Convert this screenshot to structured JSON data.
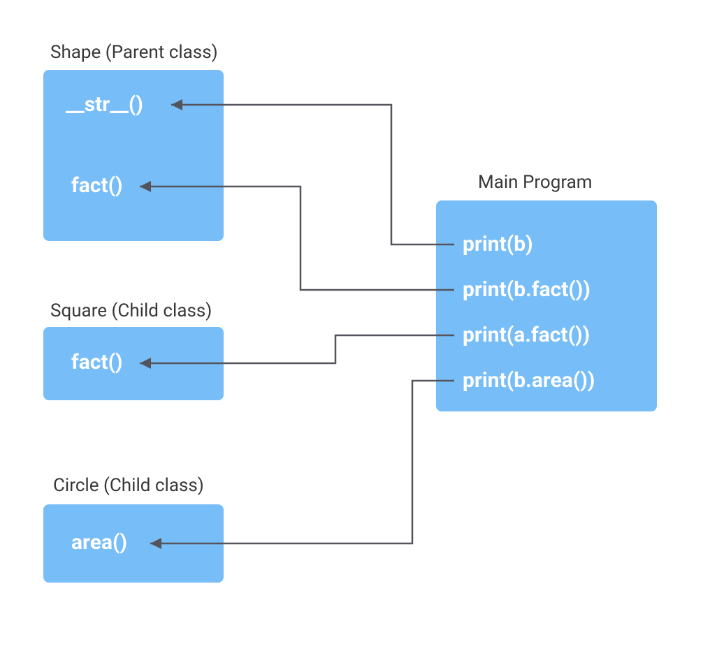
{
  "shape": {
    "title": "Shape (Parent class)",
    "methods": [
      "__str__()",
      "fact()"
    ]
  },
  "square": {
    "title": "Square (Child class)",
    "methods": [
      "fact()"
    ]
  },
  "circle": {
    "title": "Circle (Child class)",
    "methods": [
      "area()"
    ]
  },
  "main": {
    "title": "Main Program",
    "lines": [
      "print(b)",
      "print(b.fact())",
      "print(a.fact())",
      "print(b.area())"
    ]
  },
  "colors": {
    "box": "#77bdf7",
    "connector": "#54545c",
    "text": "#383838"
  }
}
